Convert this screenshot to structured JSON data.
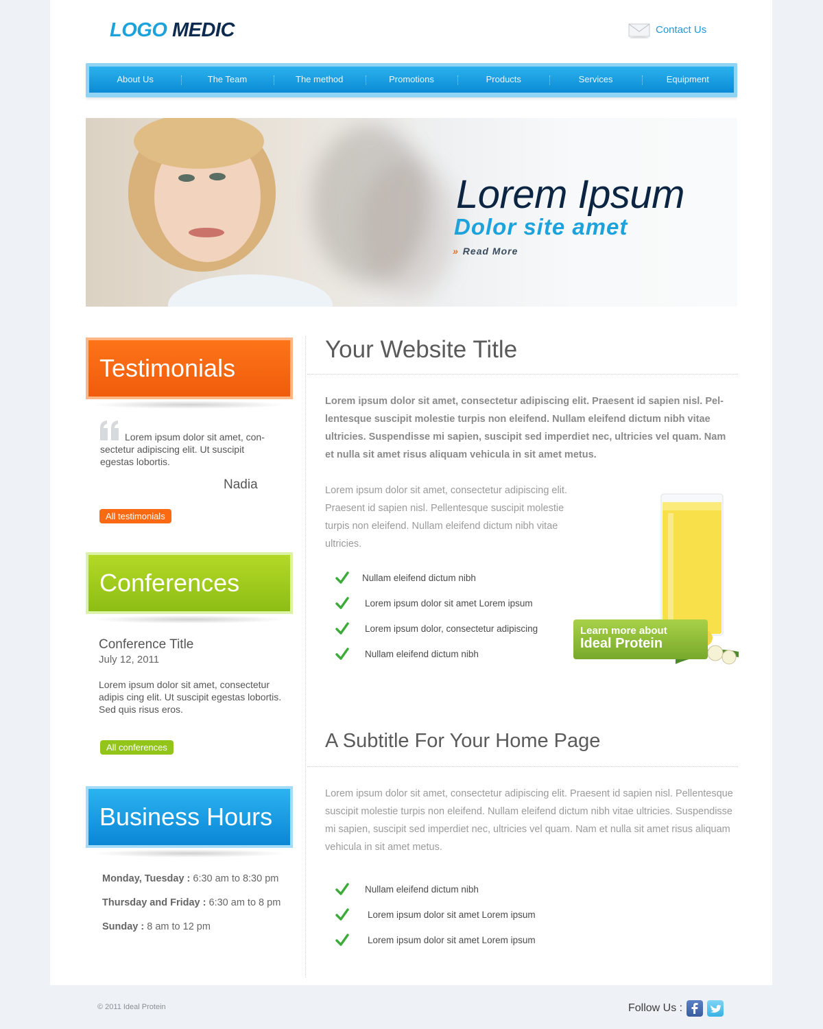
{
  "header": {
    "logo_part1": "LOGO",
    "logo_part2": "MEDIC",
    "contact_label": "Contact Us"
  },
  "nav": {
    "items": [
      "About Us",
      "The Team",
      "The method",
      "Promotions",
      "Products",
      "Services",
      "Equipment"
    ]
  },
  "hero": {
    "title": "Lorem Ipsum",
    "subtitle": "Dolor site amet",
    "read_more_arrow": "»",
    "read_more": "Read More"
  },
  "sidebar": {
    "testimonials": {
      "heading": "Testimonials",
      "quote": "Lorem ipsum dolor sit amet, con-sectetur adipiscing elit. Ut suscipit egestas lobortis.",
      "author": "Nadia",
      "button": "All testimonials",
      "color": "#fb6a12"
    },
    "conferences": {
      "heading": "Conferences",
      "title": "Conference Title",
      "date": "July 12, 2011",
      "text": "Lorem ipsum dolor sit amet, consectetur adipis cing elit. Ut suscipit egestas lobortis. Sed quis risus eros.",
      "button": "All conferences",
      "color": "#9ccb1d"
    },
    "hours": {
      "heading": "Business Hours",
      "rows": [
        {
          "day": "Monday, Tuesday :",
          "time": " 6:30 am to 8:30 pm"
        },
        {
          "day": "Thursday and Friday :",
          "time": " 6:30 am to 8 pm"
        },
        {
          "day": "Sunday :",
          "time": " 8 am to 12 pm"
        }
      ],
      "color": "#1a9fe6"
    }
  },
  "main": {
    "title": "Your Website Title",
    "intro": "Lorem ipsum dolor sit amet, consectetur adipiscing elit. Praesent id sapien nisl. Pel-lentesque suscipit molestie turpis non eleifend. Nullam eleifend dictum nibh vitae ultricies. Suspendisse mi sapien, suscipit sed imperdiet nec, ultricies vel quam. Nam et nulla sit amet risus aliquam vehicula in sit amet metus.",
    "paragraph": "Lorem ipsum dolor sit amet, consectetur adipiscing elit. Praesent id sapien nisl. Pellentesque suscipit molestie turpis non eleifend. Nullam eleifend dictum nibh vitae ultricies.",
    "checklist": [
      "Nullam eleifend dictum nibh",
      "Lorem ipsum dolor sit amet Lorem ipsum",
      "Lorem ipsum dolor, consectetur adipiscing",
      "Nullam eleifend dictum nibh"
    ],
    "badge_line1": "Learn more about",
    "badge_line2": "Ideal Protein",
    "subtitle": "A Subtitle For Your Home Page",
    "paragraph2": "Lorem ipsum dolor sit amet, consectetur adipiscing elit. Praesent id sapien nisl. Pellentesque suscipit molestie turpis non eleifend. Nullam eleifend dictum nibh vitae ultricies. Suspendisse mi sapien, suscipit sed imperdiet nec, ultricies vel quam. Nam et nulla sit amet risus aliquam vehicula in sit amet metus.",
    "checklist2": [
      "Nullam eleifend dictum nibh",
      "Lorem ipsum dolor sit amet Lorem ipsum",
      "Lorem ipsum dolor sit amet Lorem ipsum"
    ]
  },
  "footer": {
    "copyright": "© 2011 Ideal Protein",
    "follow": "Follow Us :",
    "social_icons": [
      "facebook-icon",
      "twitter-icon"
    ]
  },
  "colors": {
    "accent_blue": "#1ea2dc",
    "navy": "#0d2a4f",
    "orange": "#fb6a12",
    "green": "#9ccb1d",
    "check_green": "#3dab3a"
  }
}
